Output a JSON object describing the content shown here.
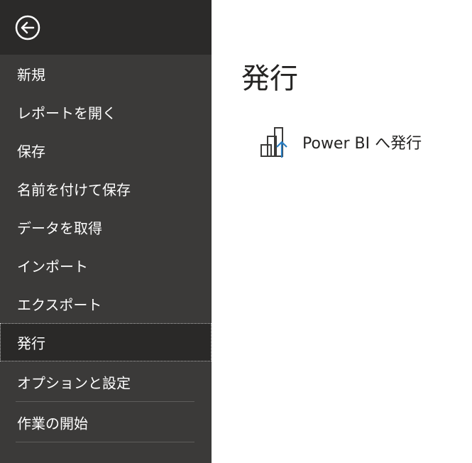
{
  "sidebar": {
    "back_icon": "back-arrow-icon",
    "items": [
      {
        "label": "新規"
      },
      {
        "label": "レポートを開く"
      },
      {
        "label": "保存"
      },
      {
        "label": "名前を付けて保存"
      },
      {
        "label": "データを取得"
      },
      {
        "label": "インポート"
      },
      {
        "label": "エクスポート"
      },
      {
        "label": "発行"
      },
      {
        "label": "オプションと設定"
      },
      {
        "label": "作業の開始"
      }
    ]
  },
  "main": {
    "title": "発行",
    "options": [
      {
        "label": "Power BI へ発行",
        "icon": "publish-to-power-bi-icon"
      }
    ]
  },
  "colors": {
    "sidebar_bg": "#3b3a39",
    "sidebar_header_bg": "#2b2a29",
    "selected_bg": "#2a2928",
    "accent": "#2b7ec1"
  }
}
